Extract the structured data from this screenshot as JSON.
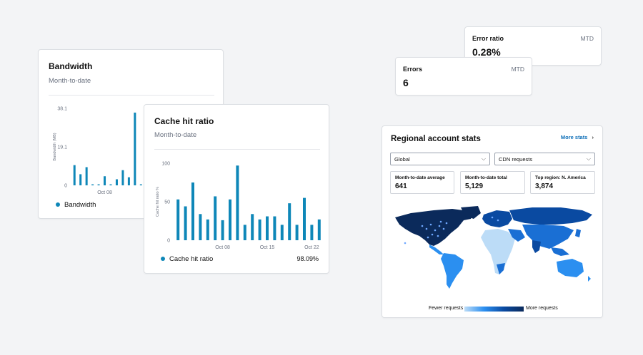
{
  "bandwidth": {
    "title": "Bandwidth",
    "subtitle": "Month-to-date",
    "legend": "Bandwidth",
    "chart_data": {
      "type": "bar",
      "ylabel": "Bandwidth (MB)",
      "yticks": [
        "38.1",
        "19.1",
        "0"
      ],
      "xticks": [
        "Oct 08"
      ],
      "ylim": [
        0,
        38.1
      ],
      "values": [
        10,
        5.5,
        9,
        0.5,
        0.5,
        4.5,
        0.5,
        3,
        7.5,
        4,
        36,
        0.5,
        0.5
      ],
      "color": "#0e87b8"
    }
  },
  "cache": {
    "title": "Cache hit ratio",
    "subtitle": "Month-to-date",
    "legend": "Cache hit ratio",
    "legend_value": "98.09%",
    "chart_data": {
      "type": "bar",
      "ylabel": "Cache hit ratio %",
      "yticks": [
        "100",
        "50",
        "0"
      ],
      "xticks": [
        "Oct 08",
        "Oct 15",
        "Oct 22"
      ],
      "ylim": [
        0,
        100
      ],
      "values": [
        53,
        44,
        75,
        34,
        27,
        57,
        26,
        53,
        97,
        20,
        34,
        27,
        31,
        31,
        20,
        48,
        20,
        55,
        20,
        27
      ],
      "color": "#0e87b8"
    }
  },
  "error_ratio": {
    "title": "Error ratio",
    "period": "MTD",
    "value": "0.28%"
  },
  "errors": {
    "title": "Errors",
    "period": "MTD",
    "value": "6"
  },
  "regional": {
    "title": "Regional account stats",
    "more_link": "More stats",
    "more_icon": "›",
    "select_region": "Global",
    "select_metric": "CDN requests",
    "stats": [
      {
        "label": "Month-to-date average",
        "value": "641"
      },
      {
        "label": "Month-to-date total",
        "value": "5,129"
      },
      {
        "label": "Top region: N. America",
        "value": "3,874"
      }
    ],
    "scale_low": "Fewer requests",
    "scale_high": "More requests",
    "colors": {
      "darkest": "#0b2a5b",
      "dark": "#0a4aa1",
      "mid": "#1a6fd4",
      "light": "#2b8ff0",
      "lightest": "#bcdcf7"
    }
  }
}
